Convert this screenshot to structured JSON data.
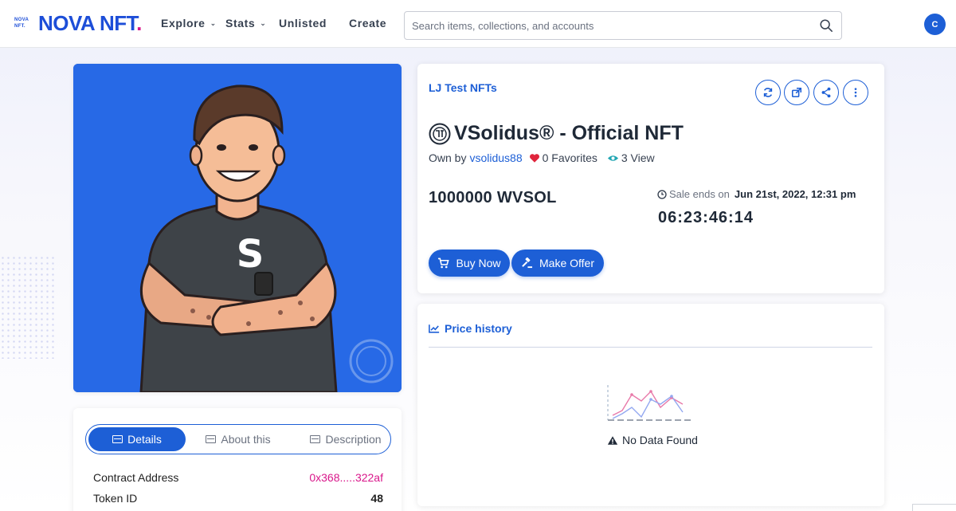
{
  "header": {
    "logo_small": "NOVA NFT.",
    "logo_text": "NOVA NFT",
    "logo_dot": ".",
    "nav": {
      "explore": "Explore",
      "stats": "Stats",
      "unlisted": "Unlisted",
      "create": "Create"
    },
    "search_placeholder": "Search items, collections, and accounts",
    "wallet_initial": "C"
  },
  "nft": {
    "collection": "LJ Test NFTs",
    "title": "VSolidus® - Official NFT",
    "own_by_label": "Own by",
    "owner": "vsolidus88",
    "favorites": "0 Favorites",
    "views": "3 View",
    "price": "1000000 WVSOL",
    "sale_label": "Sale ends on",
    "sale_date": "Jun 21st, 2022, 12:31 pm",
    "countdown": "06:23:46:14",
    "buy_label": "Buy Now",
    "offer_label": "Make Offer"
  },
  "details": {
    "tabs": [
      "Details",
      "About this",
      "Description"
    ],
    "active_tab": "Details",
    "rows": [
      {
        "label": "Contract Address",
        "value": "0x368.....322af"
      },
      {
        "label": "Token ID",
        "value": "48"
      }
    ]
  },
  "price_history": {
    "title": "Price history",
    "empty_text": "No Data Found"
  },
  "colors": {
    "primary": "#1d5fd6",
    "accent": "#d9168a",
    "image_bg": "#2769e6"
  },
  "icons": [
    "search-icon",
    "refresh-icon",
    "external-link-icon",
    "share-icon",
    "more-icon",
    "heart-icon",
    "eye-icon",
    "clock-icon",
    "cart-icon",
    "gavel-icon",
    "chart-line-icon",
    "warning-icon"
  ]
}
